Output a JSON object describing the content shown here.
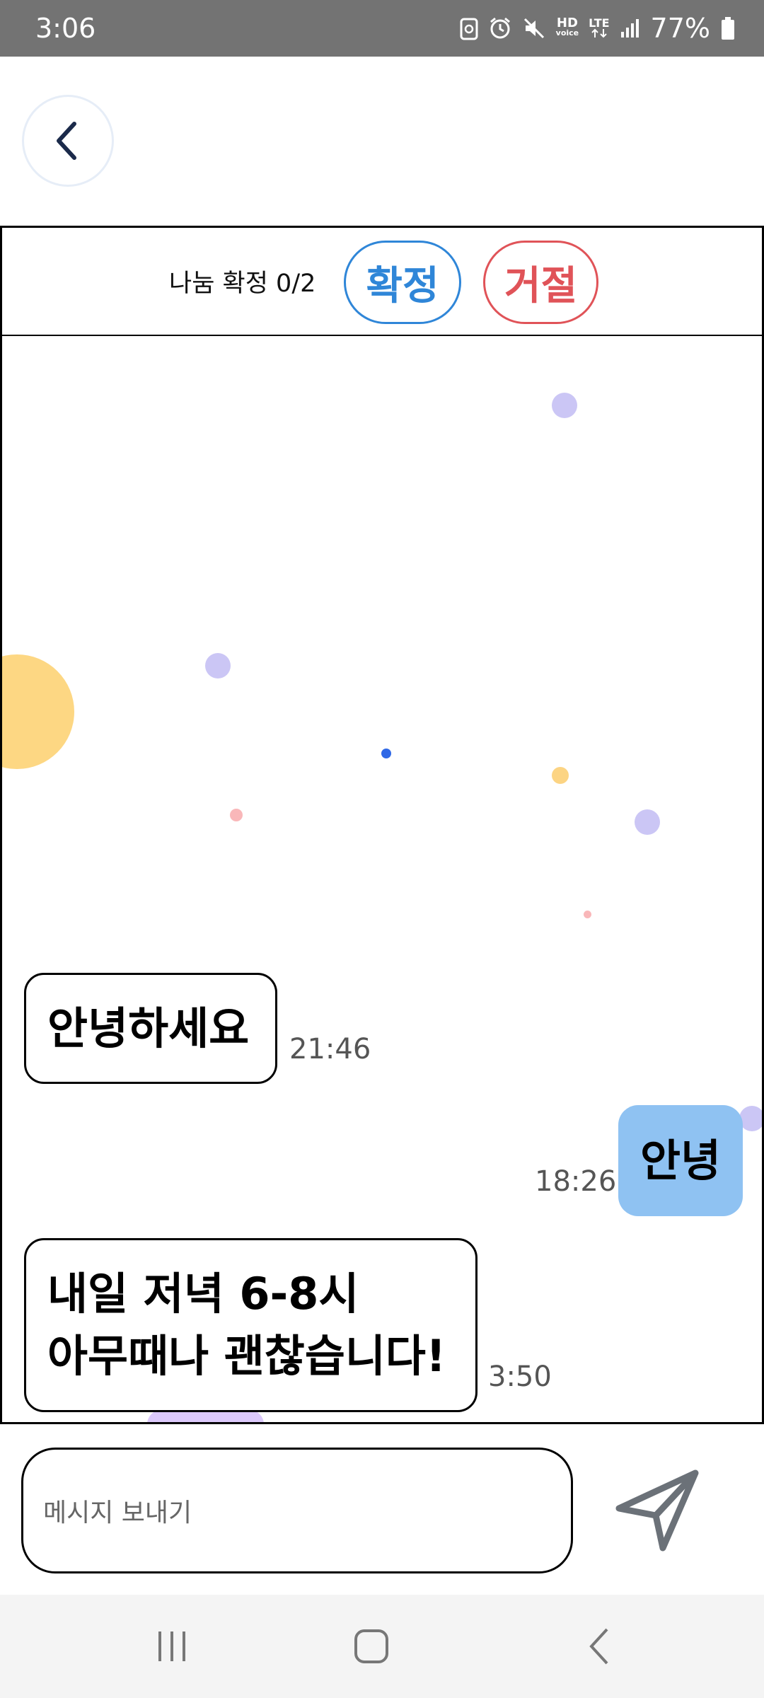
{
  "status_bar": {
    "time": "3:06",
    "hd_top": "HD",
    "hd_bottom": "voice",
    "lte": "LTE",
    "battery_percent": "77%",
    "icons": [
      "recycle-notification-icon",
      "alarm-icon",
      "mute-icon",
      "hd-voice-icon",
      "lte-icon",
      "signal-icon",
      "battery-icon"
    ]
  },
  "header": {
    "deal_status": "나눔 확정 0/2",
    "confirm_label": "확정",
    "reject_label": "거절"
  },
  "messages": [
    {
      "direction": "in",
      "text": "안녕하세요",
      "time": "21:46"
    },
    {
      "direction": "out",
      "text": "안녕",
      "time": "18:26"
    },
    {
      "direction": "in",
      "lines": [
        "내일 저녁 6-8시",
        "아무때나 괜찮습니다!"
      ],
      "time": "3:50"
    }
  ],
  "composer": {
    "placeholder": "메시지 보내기"
  },
  "colors": {
    "status_bar": "#737373",
    "confirm": "#2f86d8",
    "reject": "#e05358",
    "outgoing_bubble": "#8fc2f2",
    "send_icon": "#6b7178"
  }
}
